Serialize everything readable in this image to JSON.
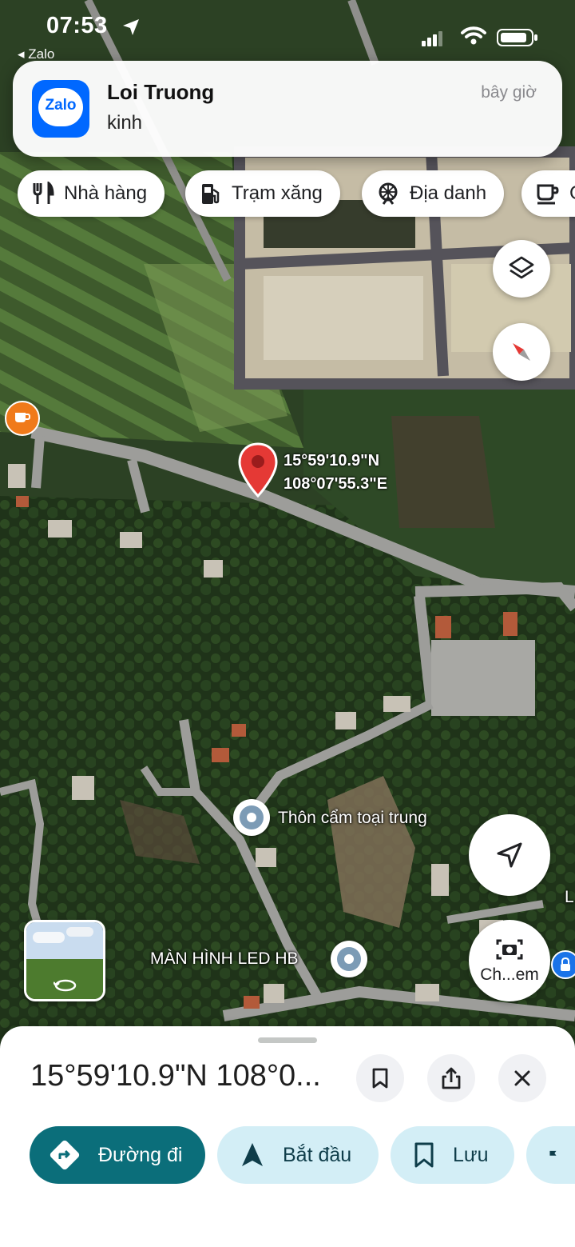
{
  "status_bar": {
    "time": "07:53",
    "back_app": "◂ Zalo"
  },
  "notification": {
    "app_logo_text": "Zalo",
    "sender": "Loi Truong",
    "message": "kinh",
    "time": "bây giờ"
  },
  "category_chips": [
    {
      "label": "Nhà hàng",
      "icon": "fork-knife-icon"
    },
    {
      "label": "Trạm xăng",
      "icon": "gas-station-icon"
    },
    {
      "label": "Địa danh",
      "icon": "landmark-icon"
    },
    {
      "label": "C",
      "icon": "coffee-icon"
    }
  ],
  "map": {
    "pin_lat": "15°59'10.9\"N",
    "pin_lng": "108°07'55.3\"E",
    "poi_1": "Thôn cẩm toại trung",
    "poi_2": "MÀN HÌNH LED HB",
    "edge_label": "L",
    "camera_button_label": "Ch...em"
  },
  "bottom_sheet": {
    "title": "15°59'10.9\"N 108°0...",
    "actions": [
      {
        "label": "Đường đi",
        "icon": "directions-icon"
      },
      {
        "label": "Bắt đầu",
        "icon": "navigation-arrow-icon"
      },
      {
        "label": "Lưu",
        "icon": "bookmark-icon"
      }
    ]
  },
  "colors": {
    "primary_action": "#0b6e7a",
    "secondary_action": "#d3eef6",
    "pin": "#e53935",
    "zalo_brand": "#0068ff"
  }
}
